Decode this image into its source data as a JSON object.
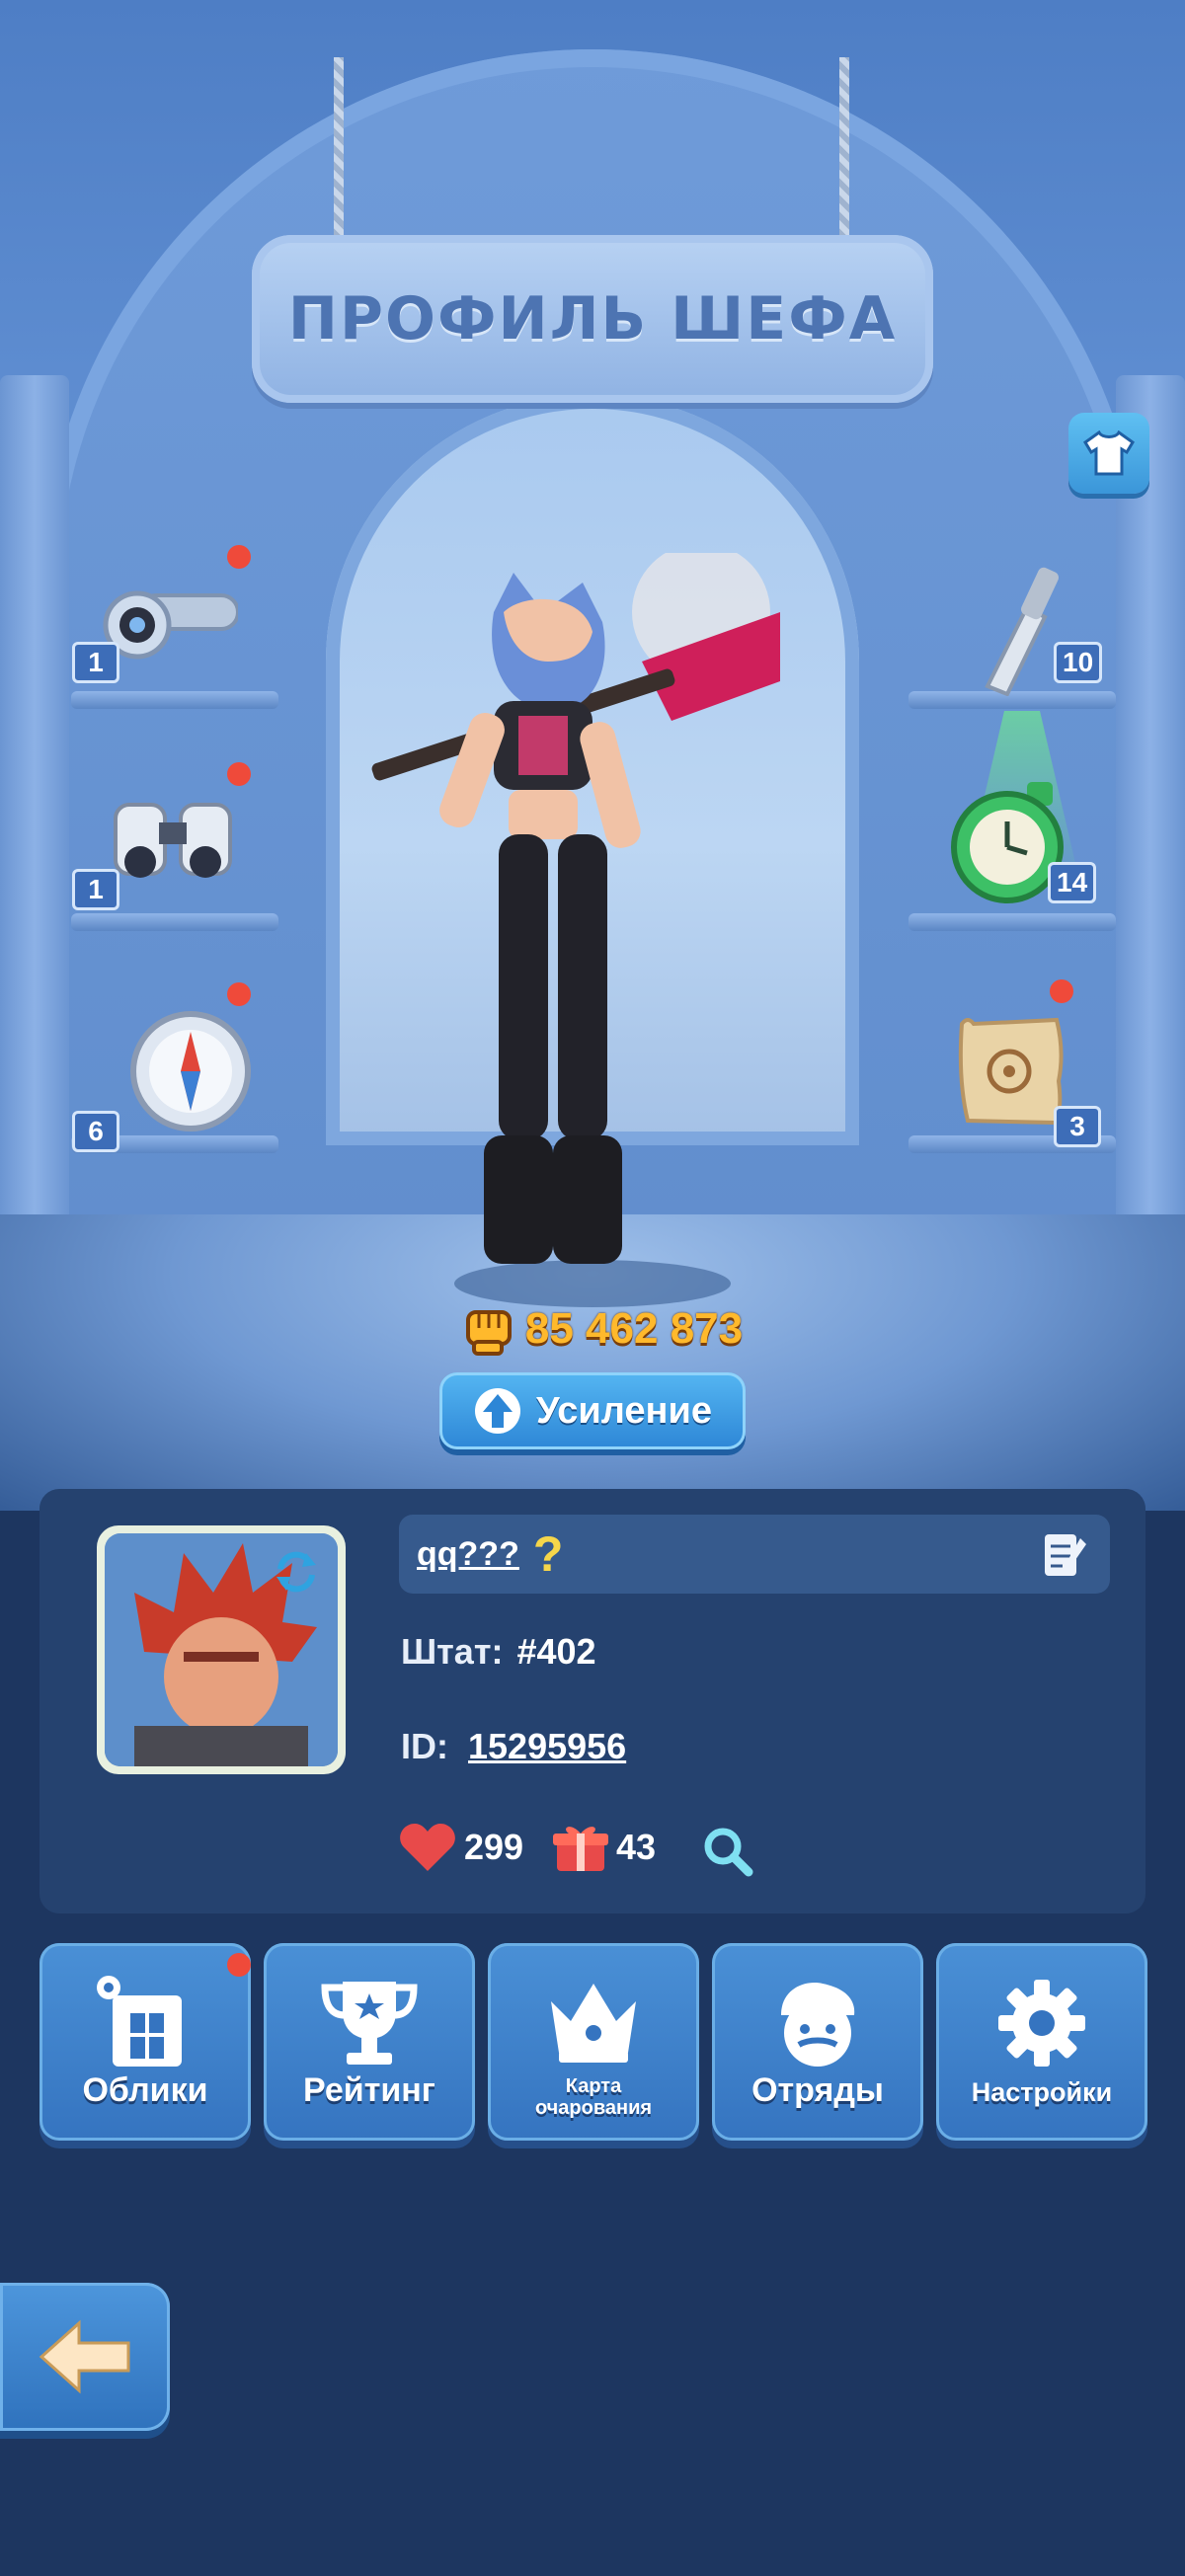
{
  "title": "ПРОФИЛЬ ШЕФА",
  "equipment": {
    "left": [
      {
        "icon": "timer-ring-icon",
        "count": "1",
        "alert": true
      },
      {
        "icon": "binoculars-icon",
        "count": "1",
        "alert": true
      },
      {
        "icon": "compass-icon",
        "count": "6",
        "alert": true
      }
    ],
    "right": [
      {
        "icon": "knife-icon",
        "count": "10",
        "alert": false
      },
      {
        "icon": "stopwatch-icon",
        "count": "14",
        "alert": false
      },
      {
        "icon": "scroll-map-icon",
        "count": "3",
        "alert": true
      }
    ]
  },
  "power": {
    "value": "85 462 873",
    "icon": "fist-icon"
  },
  "boost_button": {
    "label": "Усиление",
    "icon": "arrow-up-icon"
  },
  "profile": {
    "name": "qq???",
    "name_hint": "?",
    "state_label": "Штат:",
    "state_value": "#402",
    "id_label": "ID:",
    "id_value": "15295956",
    "likes": "299",
    "gifts": "43"
  },
  "menu": [
    {
      "label": "Облики",
      "icon": "shop-skins-icon",
      "alert": true
    },
    {
      "label": "Рейтинг",
      "icon": "trophy-icon",
      "alert": false
    },
    {
      "label": "Карта очарования",
      "icon": "crown-icon",
      "alert": false
    },
    {
      "label": "Отряды",
      "icon": "squad-chef-icon",
      "alert": false
    },
    {
      "label": "Настройки",
      "icon": "gear-icon",
      "alert": false
    }
  ],
  "colors": {
    "alert": "#ef4a3a",
    "power": "#ffb92c",
    "accent": "#3b96d9"
  }
}
